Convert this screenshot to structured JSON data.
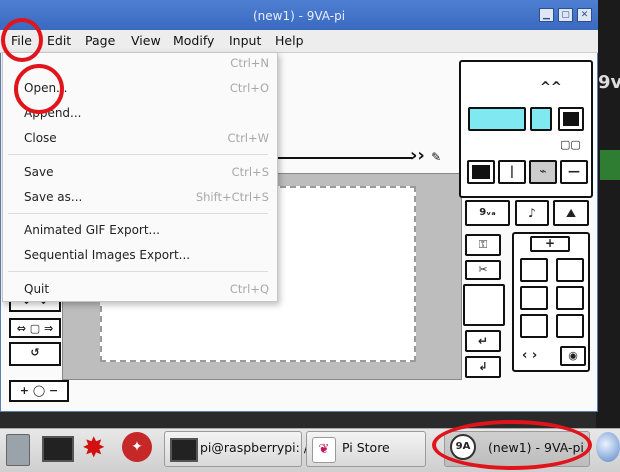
{
  "window": {
    "title": "(new1) - 9VA-pi"
  },
  "menubar": {
    "items": [
      "File",
      "Edit",
      "Page",
      "View",
      "Modify",
      "Input",
      "Help"
    ]
  },
  "file_menu": {
    "items": [
      {
        "label": "",
        "shortcut": "Ctrl+N"
      },
      {
        "label": "Open...",
        "shortcut": "Ctrl+O"
      },
      {
        "label": "Append...",
        "shortcut": ""
      },
      {
        "label": "Close",
        "shortcut": "Ctrl+W"
      },
      {
        "label": "Save",
        "shortcut": "Ctrl+S"
      },
      {
        "label": "Save as...",
        "shortcut": "Shift+Ctrl+S"
      },
      {
        "label": "Animated GIF Export...",
        "shortcut": ""
      },
      {
        "label": "Sequential Images Export...",
        "shortcut": ""
      },
      {
        "label": "Quit",
        "shortcut": "Ctrl+Q"
      }
    ]
  },
  "taskbar": {
    "terminal_task": "pi@raspberrypi: /",
    "store_task": "Pi Store",
    "app_task": "(new1) - 9VA-pi"
  },
  "desktop": {
    "partial_text": "9v"
  },
  "annotation_color": "#e0151b"
}
